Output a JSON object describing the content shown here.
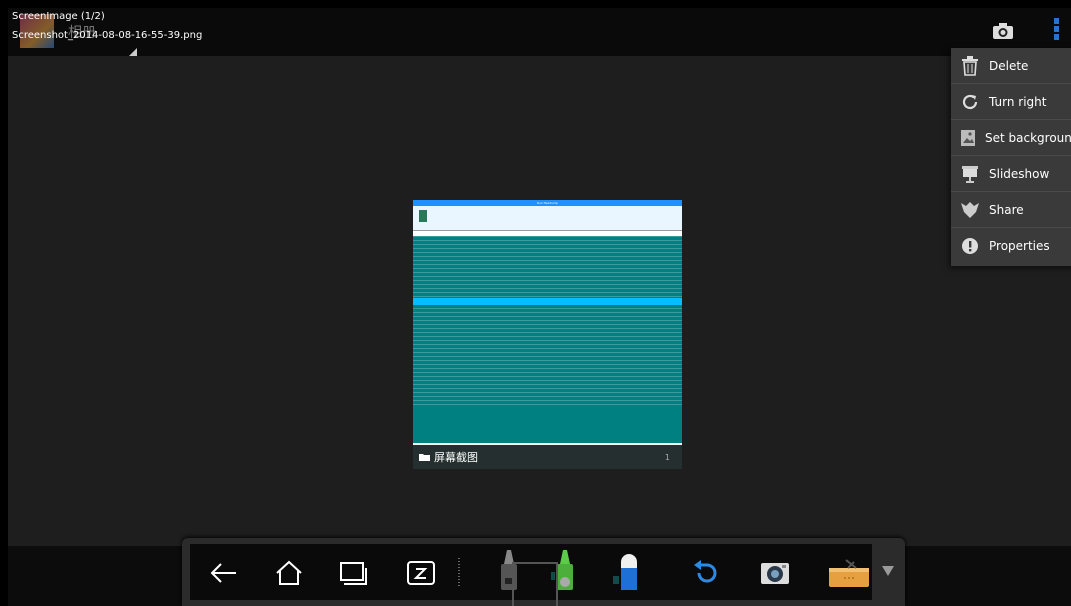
{
  "header": {
    "title": "ScreenImage (1/2)",
    "filename": "Screenshot_2014-08-08-16-55-39.png",
    "album_label": "相册",
    "camera_icon": "camera-icon",
    "overflow_icon": "overflow-menu-icon"
  },
  "menu": {
    "items": [
      {
        "label": "Delete",
        "icon": "trash-icon"
      },
      {
        "label": "Turn right",
        "icon": "rotate-right-icon"
      },
      {
        "label": "Set background",
        "icon": "wallpaper-icon"
      },
      {
        "label": "Slideshow",
        "icon": "slideshow-icon"
      },
      {
        "label": "Share",
        "icon": "share-icon"
      },
      {
        "label": "Properties",
        "icon": "info-icon"
      }
    ]
  },
  "photo": {
    "caption": "屏幕截图",
    "count": "1",
    "window_title": "Run Hexdump"
  },
  "dock": {
    "items": [
      {
        "name": "back-icon"
      },
      {
        "name": "home-icon"
      },
      {
        "name": "recent-apps-icon"
      },
      {
        "name": "whiteboard-icon"
      },
      {
        "name": "pen-gray-icon"
      },
      {
        "name": "pen-green-icon"
      },
      {
        "name": "eraser-icon"
      },
      {
        "name": "undo-icon"
      },
      {
        "name": "camera-icon"
      },
      {
        "name": "toolbox-icon"
      }
    ]
  },
  "colors": {
    "accent": "#2a6fd6",
    "photo_bg": "#008080",
    "highlight": "#00bfff"
  }
}
